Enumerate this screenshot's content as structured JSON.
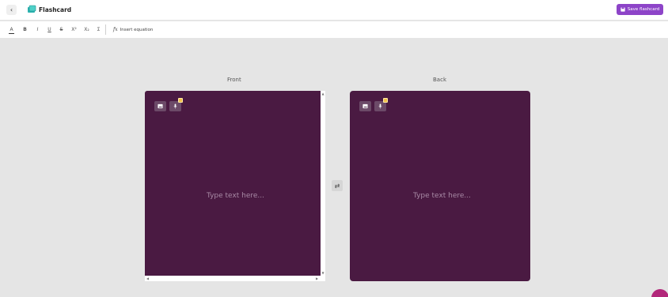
{
  "header": {
    "back_glyph": "‹",
    "title": "Flashcard",
    "save_label": "Save flashcard",
    "accent_color": "#8d44c8"
  },
  "toolbar": {
    "items": [
      {
        "name": "font-color",
        "glyph": "A"
      },
      {
        "name": "bold",
        "glyph": "B"
      },
      {
        "name": "italic",
        "glyph": "I"
      },
      {
        "name": "underline",
        "glyph": "U"
      },
      {
        "name": "strikethrough",
        "glyph": "S"
      },
      {
        "name": "superscript",
        "glyph": "X²"
      },
      {
        "name": "subscript",
        "glyph": "X₂"
      },
      {
        "name": "sum",
        "glyph": "Σ"
      }
    ],
    "equation_icon": "fx",
    "equation_label": "Insert equation"
  },
  "front": {
    "label": "Front",
    "placeholder": "Type text here...",
    "card_color": "#4a1a42"
  },
  "back": {
    "label": "Back",
    "placeholder": "Type text here...",
    "card_color": "#4a1a42"
  },
  "swap_glyph": "⇄",
  "icons": {
    "image": "image-icon",
    "mic": "microphone-icon",
    "swap": "swap-icon",
    "save": "save-icon"
  }
}
